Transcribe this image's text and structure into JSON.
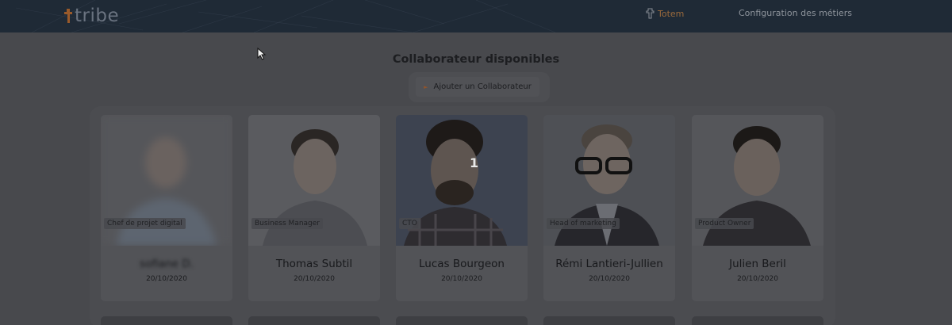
{
  "topbar": {
    "brand": "tribe",
    "nav": {
      "totem_label": "Totem",
      "config_label": "Configuration des métiers"
    },
    "accent_color": "#e0782b"
  },
  "main": {
    "title": "Collaborateur disponibles",
    "add_button_label": "Ajouter un Collaborateur",
    "step_marker": "1"
  },
  "collaborators": [
    {
      "role": "Chef de projet digital",
      "name": "sofiane D.",
      "date": "20/10/2020"
    },
    {
      "role": "Business Manager",
      "name": "Thomas Subtil",
      "date": "20/10/2020"
    },
    {
      "role": "CTO",
      "name": "Lucas Bourgeon",
      "date": "20/10/2020"
    },
    {
      "role": "Head of marketing",
      "name": "Rémi Lantieri-Jullien",
      "date": "20/10/2020"
    },
    {
      "role": "Product Owner",
      "name": "Julien Beril",
      "date": "20/10/2020"
    }
  ]
}
